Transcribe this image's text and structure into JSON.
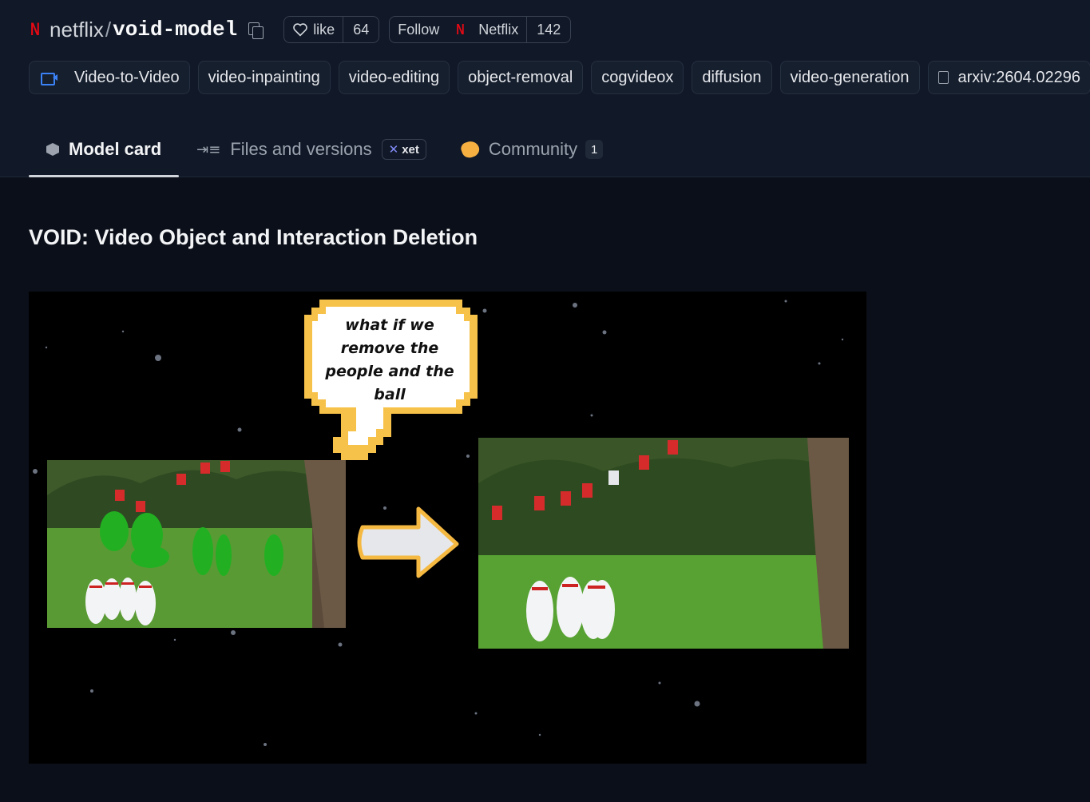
{
  "header": {
    "owner": "netflix",
    "separator": "/",
    "repo": "void-model",
    "like_label": "like",
    "like_count": "64",
    "follow_label": "Follow",
    "follow_org": "Netflix",
    "follow_count": "142"
  },
  "tags": {
    "pipeline": "Video-to-Video",
    "items": [
      "video-inpainting",
      "video-editing",
      "object-removal",
      "cogvideox",
      "diffusion",
      "video-generation"
    ],
    "arxiv": "arxiv:2604.02296"
  },
  "tabs": {
    "model_card": "Model card",
    "files": "Files and versions",
    "xet": "xet",
    "community": "Community",
    "community_count": "1"
  },
  "content": {
    "title": "VOID: Video Object and Interaction Deletion"
  },
  "media": {
    "bubble_line1": "what if we",
    "bubble_line2": "remove the",
    "bubble_line3": "people and the",
    "bubble_line4": "ball"
  },
  "colors": {
    "page_bg": "#0b0f19",
    "netflix_red": "#e50914",
    "pipeline_blue": "#3b82f6",
    "bubble_yellow": "#f7c24a"
  },
  "icons": [
    "netflix-n-logo",
    "copy-icon",
    "heart-icon",
    "video-icon",
    "document-icon",
    "cube-icon",
    "files-icon",
    "xet-icon",
    "community-hand-icon"
  ]
}
